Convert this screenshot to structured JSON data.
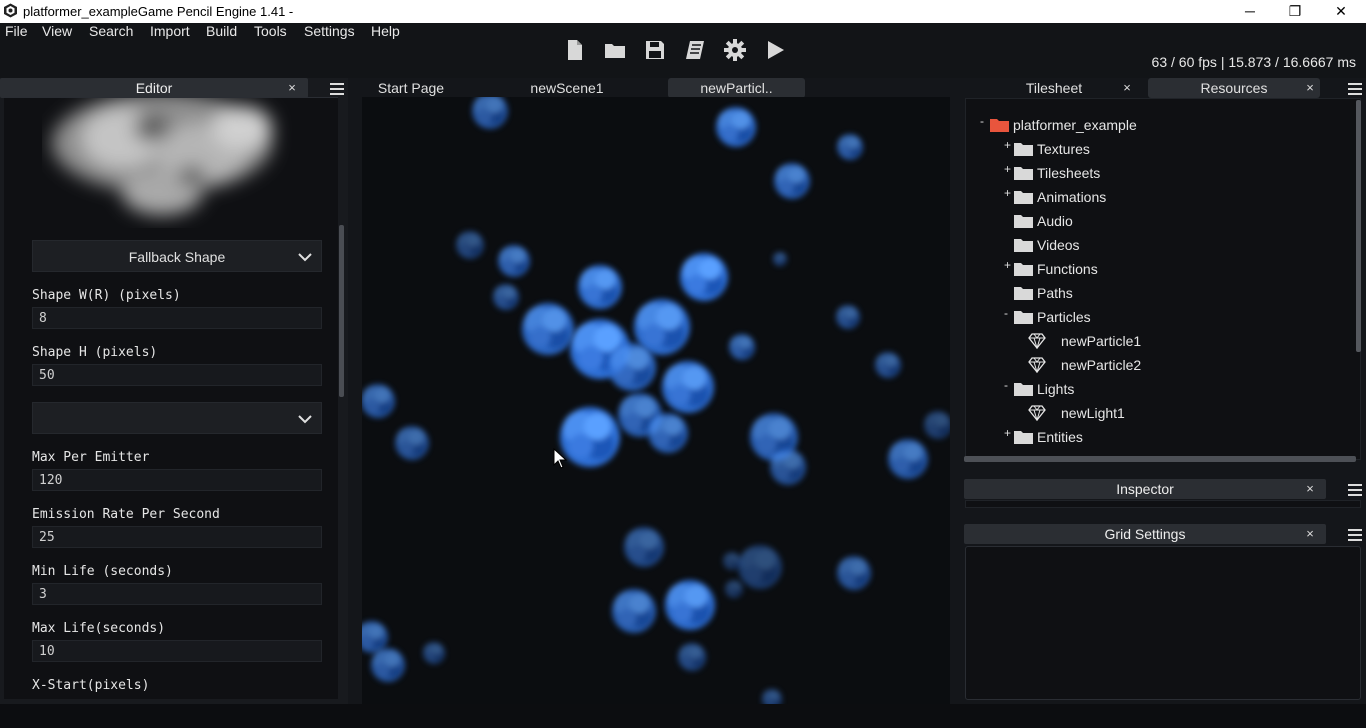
{
  "window": {
    "title": "platformer_exampleGame Pencil Engine  1.41 -",
    "controls": {
      "minimize": "─",
      "maximize": "❐",
      "close": "✕"
    }
  },
  "menubar": {
    "items": [
      "File",
      "View",
      "Search",
      "Import",
      "Build",
      "Tools",
      "Settings",
      "Help"
    ]
  },
  "toolbar": {
    "icons": [
      "new-file-icon",
      "open-folder-icon",
      "save-icon",
      "docs-book-icon",
      "settings-gear-icon",
      "play-icon"
    ]
  },
  "status": {
    "fps": "63 / 60 fps | 15.873 / 16.6667 ms"
  },
  "editor": {
    "header": "Editor",
    "close": "×",
    "fallback_shape": "Fallback Shape",
    "fields": [
      {
        "label": "Shape W(R) (pixels)",
        "value": "8"
      },
      {
        "label": "Shape H (pixels)",
        "value": "50"
      },
      {
        "label": "Max Per Emitter",
        "value": "120"
      },
      {
        "label": "Emission Rate Per Second",
        "value": "25"
      },
      {
        "label": "Min Life (seconds)",
        "value": "3"
      },
      {
        "label": "Max Life(seconds)",
        "value": "10"
      },
      {
        "label": "X-Start(pixels)",
        "value": ""
      }
    ],
    "second_dropdown": ""
  },
  "center_tabs": [
    "Start Page",
    "newScene1",
    "newParticl.."
  ],
  "right_tabs": {
    "tilesheet": "Tilesheet",
    "resources": "Resources",
    "close": "×"
  },
  "resources_tree": {
    "root": {
      "label": "platformer_example",
      "toggle": "-"
    },
    "items": [
      {
        "label": "Textures",
        "toggle": "+",
        "kind": "folder"
      },
      {
        "label": "Tilesheets",
        "toggle": "+",
        "kind": "folder"
      },
      {
        "label": "Animations",
        "toggle": "+",
        "kind": "folder"
      },
      {
        "label": "Audio",
        "toggle": "",
        "kind": "folder"
      },
      {
        "label": "Videos",
        "toggle": "",
        "kind": "folder"
      },
      {
        "label": "Functions",
        "toggle": "+",
        "kind": "folder"
      },
      {
        "label": "Paths",
        "toggle": "",
        "kind": "folder"
      },
      {
        "label": "Particles",
        "toggle": "-",
        "kind": "folder"
      },
      {
        "label": "newParticle1",
        "toggle": "",
        "kind": "particle"
      },
      {
        "label": "newParticle2",
        "toggle": "",
        "kind": "particle"
      },
      {
        "label": "Lights",
        "toggle": "-",
        "kind": "folder"
      },
      {
        "label": "newLight1",
        "toggle": "",
        "kind": "light"
      },
      {
        "label": "Entities",
        "toggle": "+",
        "kind": "folder"
      }
    ]
  },
  "inspector": {
    "header": "Inspector",
    "close": "×"
  },
  "grid_settings": {
    "header": "Grid Settings",
    "close": "×"
  },
  "colors": {
    "root_folder": "#e8553d",
    "folder": "#d9d9d9",
    "particle_blue": "#2a7bff"
  }
}
